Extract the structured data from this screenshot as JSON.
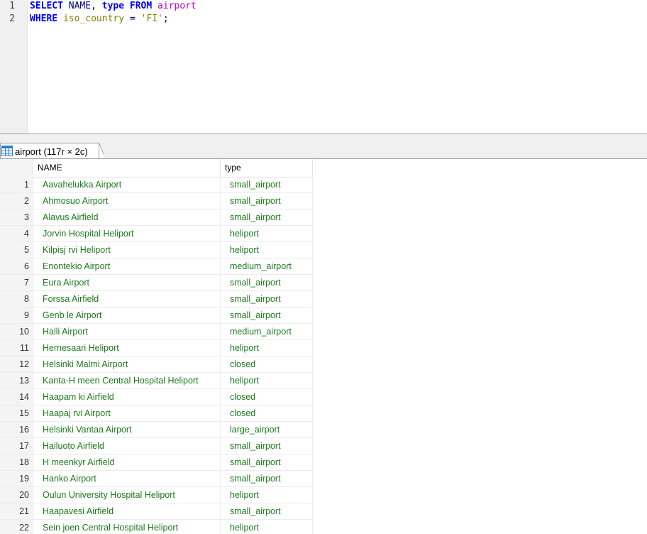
{
  "editor": {
    "line_numbers": [
      "1",
      "2"
    ],
    "line1": {
      "kw_select": "SELECT",
      "cols": " NAME, ",
      "col_type": "type",
      "kw_from": " FROM",
      "table": " airport"
    },
    "line2": {
      "kw_where": "WHERE",
      "column": " iso_country",
      "op": " = ",
      "value": "'FI'",
      "semicolon": ";"
    }
  },
  "result_tab": {
    "label": "airport (117r × 2c)",
    "icon": "table-grid-icon"
  },
  "grid": {
    "columns": [
      "NAME",
      "type"
    ],
    "rows": [
      {
        "n": "1",
        "name": "Aavahelukka Airport",
        "type": "small_airport"
      },
      {
        "n": "2",
        "name": "Ahmosuo Airport",
        "type": "small_airport"
      },
      {
        "n": "3",
        "name": "Alavus Airfield",
        "type": "small_airport"
      },
      {
        "n": "4",
        "name": "Jorvin Hospital Heliport",
        "type": "heliport"
      },
      {
        "n": "5",
        "name": "Kilpisj rvi Heliport",
        "type": "heliport"
      },
      {
        "n": "6",
        "name": "Enontekio Airport",
        "type": "medium_airport"
      },
      {
        "n": "7",
        "name": "Eura Airport",
        "type": "small_airport"
      },
      {
        "n": "8",
        "name": "Forssa Airfield",
        "type": "small_airport"
      },
      {
        "n": "9",
        "name": "Genb le Airport",
        "type": "small_airport"
      },
      {
        "n": "10",
        "name": "Halli Airport",
        "type": "medium_airport"
      },
      {
        "n": "11",
        "name": "Hernesaari Heliport",
        "type": "heliport"
      },
      {
        "n": "12",
        "name": "Helsinki Malmi Airport",
        "type": "closed"
      },
      {
        "n": "13",
        "name": "Kanta-H meen Central Hospital Heliport",
        "type": "heliport"
      },
      {
        "n": "14",
        "name": "Haapam ki Airfield",
        "type": "closed"
      },
      {
        "n": "15",
        "name": "Haapaj rvi Airport",
        "type": "closed"
      },
      {
        "n": "16",
        "name": "Helsinki Vantaa Airport",
        "type": "large_airport"
      },
      {
        "n": "17",
        "name": "Hailuoto Airfield",
        "type": "small_airport"
      },
      {
        "n": "18",
        "name": "H meenkyr  Airfield",
        "type": "small_airport"
      },
      {
        "n": "19",
        "name": "Hanko Airport",
        "type": "small_airport"
      },
      {
        "n": "20",
        "name": "Oulun University Hospital Heliport",
        "type": "heliport"
      },
      {
        "n": "21",
        "name": "Haapavesi Airfield",
        "type": "small_airport"
      },
      {
        "n": "22",
        "name": "Sein joen Central Hospital Heliport",
        "type": "heliport"
      }
    ]
  }
}
